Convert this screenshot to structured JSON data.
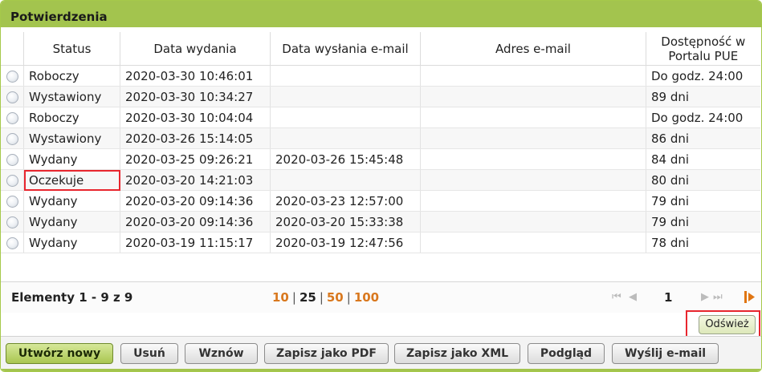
{
  "panel": {
    "title": "Potwierdzenia"
  },
  "table": {
    "columns": [
      "Status",
      "Data wydania",
      "Data wysłania e-mail",
      "Adres e-mail",
      "Dostępność w",
      "Portalu PUE"
    ],
    "rows": [
      {
        "status": "Roboczy",
        "issued": "2020-03-30 10:46:01",
        "sent": "",
        "email": "",
        "availability": "Do godz. 24:00"
      },
      {
        "status": "Wystawiony",
        "issued": "2020-03-30 10:34:27",
        "sent": "",
        "email": "",
        "availability": "89 dni"
      },
      {
        "status": "Roboczy",
        "issued": "2020-03-30 10:04:04",
        "sent": "",
        "email": "",
        "availability": "Do godz. 24:00"
      },
      {
        "status": "Wystawiony",
        "issued": "2020-03-26 15:14:05",
        "sent": "",
        "email": "",
        "availability": "86 dni"
      },
      {
        "status": "Wydany",
        "issued": "2020-03-25 09:26:21",
        "sent": "2020-03-26 15:45:48",
        "email": "",
        "availability": "84 dni"
      },
      {
        "status": "Oczekuje",
        "issued": "2020-03-20 14:21:03",
        "sent": "",
        "email": "",
        "availability": "80 dni"
      },
      {
        "status": "Wydany",
        "issued": "2020-03-20 09:14:36",
        "sent": "2020-03-23 12:57:00",
        "email": "",
        "availability": "79 dni"
      },
      {
        "status": "Wydany",
        "issued": "2020-03-20 09:14:36",
        "sent": "2020-03-20 15:33:38",
        "email": "",
        "availability": "79 dni"
      },
      {
        "status": "Wydany",
        "issued": "2020-03-19 11:15:17",
        "sent": "2020-03-19 12:47:56",
        "email": "",
        "availability": "78 dni"
      }
    ]
  },
  "pager": {
    "counter": "Elementy 1 - 9 z 9",
    "sizes": [
      "10",
      "25",
      "50",
      "100"
    ],
    "separator": "|",
    "page": "1",
    "first_glyph": "⏮",
    "prev_glyph": "◀",
    "next_glyph": "▶",
    "last_glyph": "⏭"
  },
  "refresh_label": "Odśwież",
  "buttons": {
    "create": "Utwórz nowy",
    "delete": "Usuń",
    "resume": "Wznów",
    "save_pdf": "Zapisz jako PDF",
    "save_xml": "Zapisz jako XML",
    "preview": "Podgląd",
    "send_email": "Wyślij e-mail"
  },
  "colors": {
    "header_green": "#a3c44e",
    "link_orange": "#d9781e",
    "highlight_red": "#e8262e"
  }
}
